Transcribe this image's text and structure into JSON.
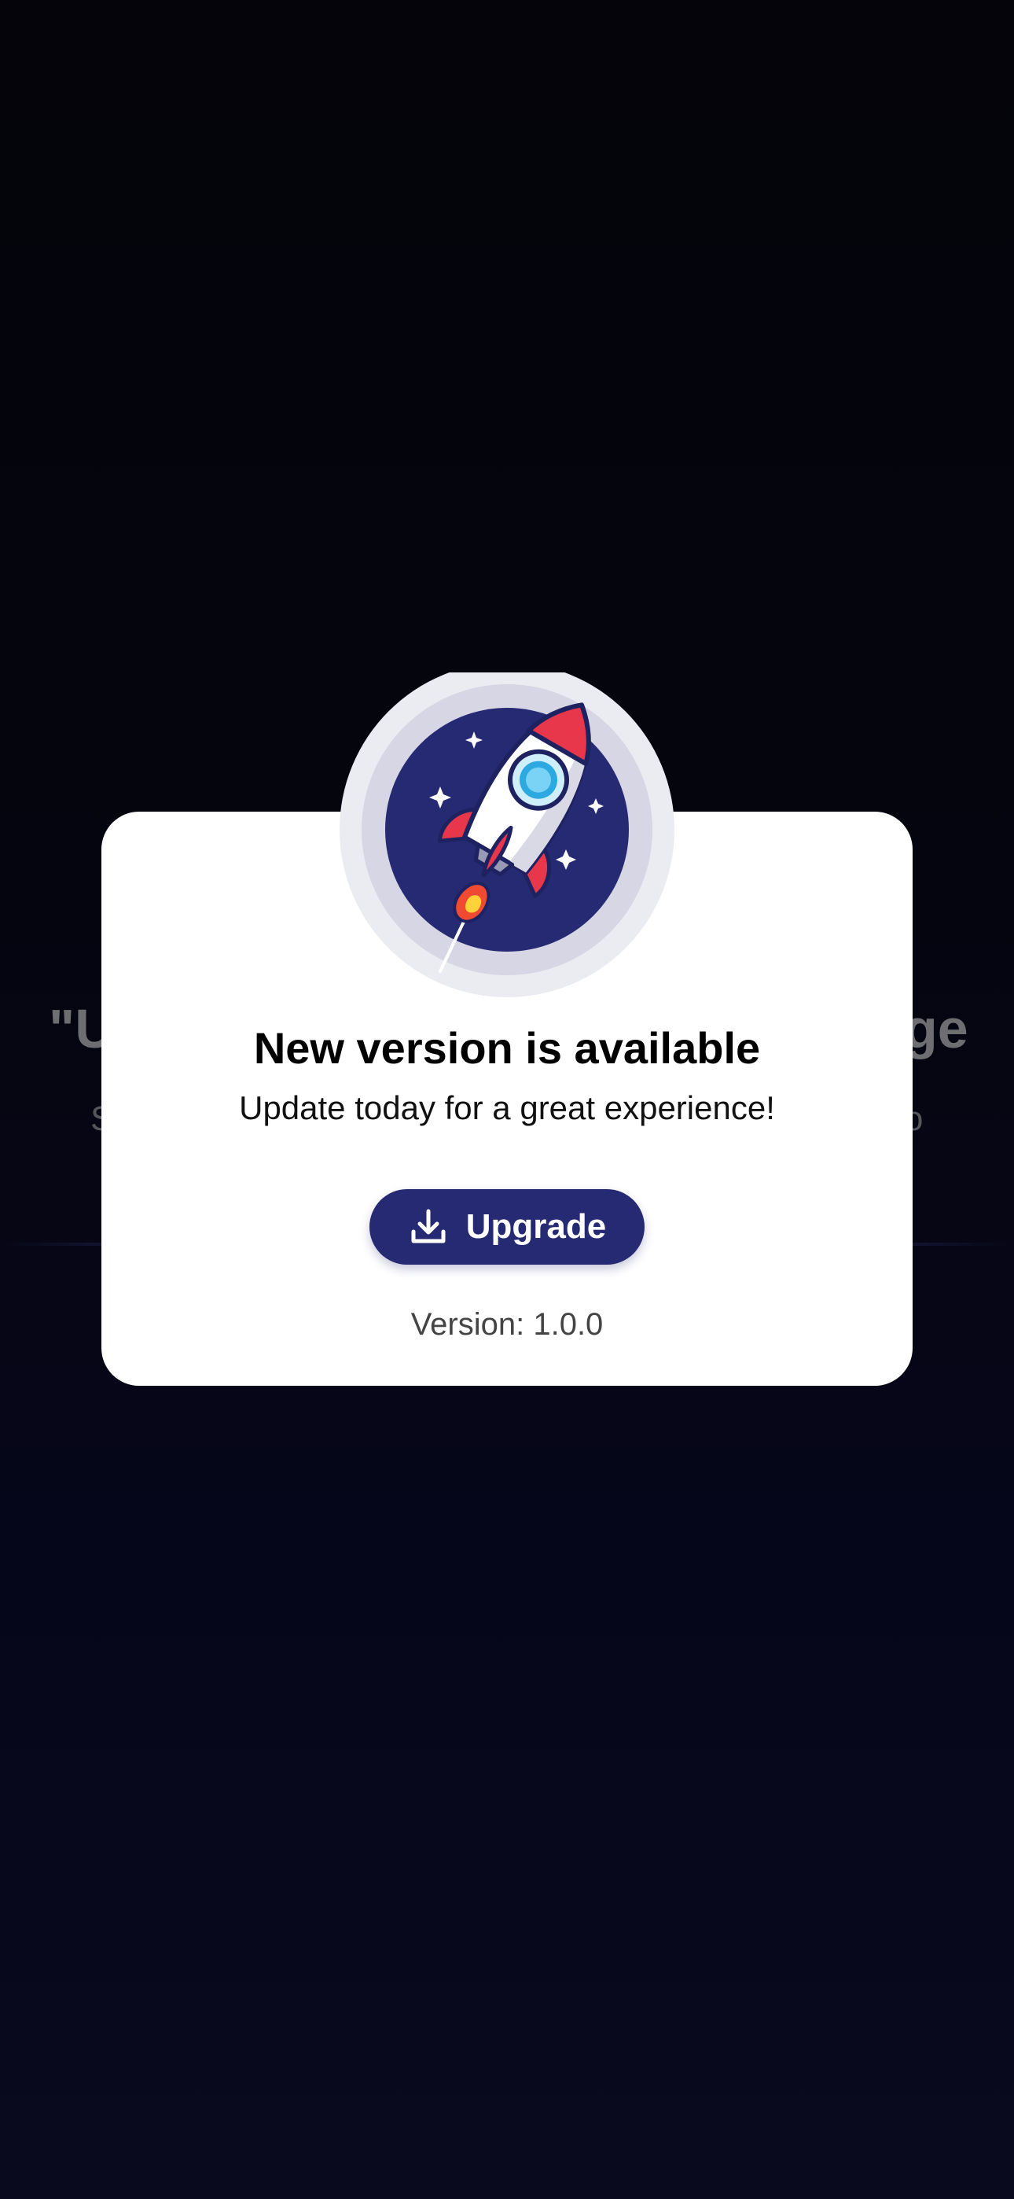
{
  "background": {
    "headline_left": "\"U",
    "headline_right": "ge",
    "subtitle_left": "S",
    "subtitle_right": "o"
  },
  "dialog": {
    "title": "New version is available",
    "subtitle": "Update today for a great experience!",
    "upgrade_label": "Upgrade",
    "version_text": "Version: 1.0.0"
  },
  "colors": {
    "accent": "#262a72",
    "rocket_red": "#e8364a",
    "circle_bg": "#252a73",
    "halo": "#dcdce8"
  },
  "icons": {
    "hero": "rocket-icon",
    "button": "download-icon"
  }
}
